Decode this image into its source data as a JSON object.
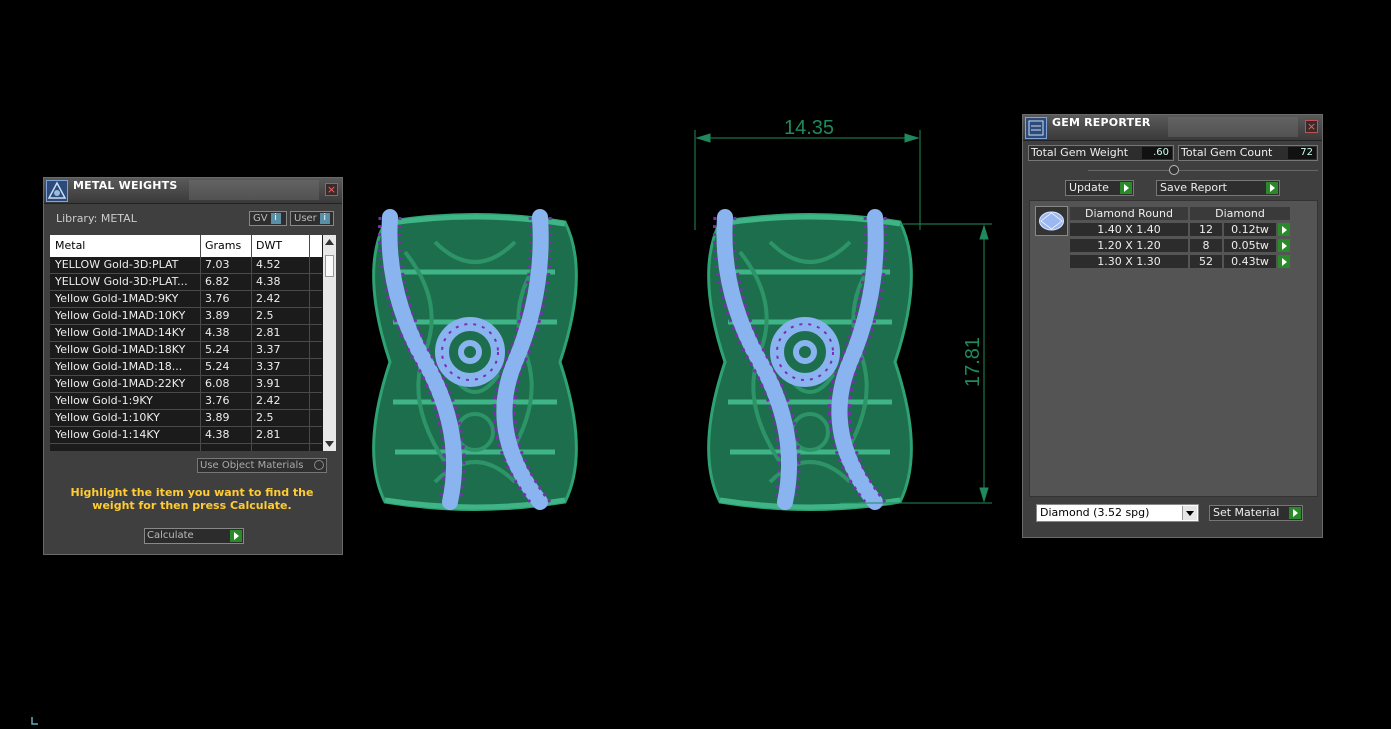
{
  "metal_weights": {
    "title": "METAL WEIGHTS",
    "library_label": "Library: METAL",
    "gv_label": "GV",
    "user_label": "User",
    "info_glyph": "i",
    "columns": [
      "Metal",
      "Grams",
      "DWT"
    ],
    "rows": [
      {
        "metal": "YELLOW Gold-3D:PLAT",
        "grams": "7.03",
        "dwt": "4.52"
      },
      {
        "metal": "YELLOW Gold-3D:PLAT...",
        "grams": "6.82",
        "dwt": "4.38"
      },
      {
        "metal": "Yellow Gold-1MAD:9KY",
        "grams": "3.76",
        "dwt": "2.42"
      },
      {
        "metal": "Yellow Gold-1MAD:10KY",
        "grams": "3.89",
        "dwt": "2.5"
      },
      {
        "metal": "Yellow Gold-1MAD:14KY",
        "grams": "4.38",
        "dwt": "2.81"
      },
      {
        "metal": "Yellow Gold-1MAD:18KY",
        "grams": "5.24",
        "dwt": "3.37"
      },
      {
        "metal": "Yellow Gold-1MAD:18...",
        "grams": "5.24",
        "dwt": "3.37"
      },
      {
        "metal": "Yellow Gold-1MAD:22KY",
        "grams": "6.08",
        "dwt": "3.91"
      },
      {
        "metal": "Yellow Gold-1:9KY",
        "grams": "3.76",
        "dwt": "2.42"
      },
      {
        "metal": "Yellow Gold-1:10KY",
        "grams": "3.89",
        "dwt": "2.5"
      },
      {
        "metal": "Yellow Gold-1:14KY",
        "grams": "4.38",
        "dwt": "2.81"
      }
    ],
    "use_object_materials_label": "Use Object Materials",
    "hint": "Highlight the item you want to find the weight for then press Calculate.",
    "calculate_label": "Calculate",
    "close_glyph": "×"
  },
  "dimensions": {
    "width": "14.35",
    "height": "17.81"
  },
  "gem_reporter": {
    "title": "GEM REPORTER",
    "close_glyph": "×",
    "total_weight_label": "Total Gem Weight",
    "total_weight_value": ".60",
    "total_count_label": "Total Gem Count",
    "total_count_value": "72",
    "update_label": "Update",
    "save_report_label": "Save Report",
    "table_headers": [
      "Diamond Round",
      "Diamond"
    ],
    "rows": [
      {
        "size": "1.40 X 1.40",
        "count": "12",
        "weight": "0.12tw"
      },
      {
        "size": "1.20 X 1.20",
        "count": "8",
        "weight": "0.05tw"
      },
      {
        "size": "1.30 X 1.30",
        "count": "52",
        "weight": "0.43tw"
      }
    ],
    "material_select": "Diamond    (3.52 spg)",
    "set_material_label": "Set Material"
  },
  "colors": {
    "metal": "#1f7a55",
    "gem_stone": "#8ab4f0",
    "prong": "#7a2fb0",
    "dimension_line": "#1f8a5c",
    "hint_text": "#ffcc33"
  }
}
